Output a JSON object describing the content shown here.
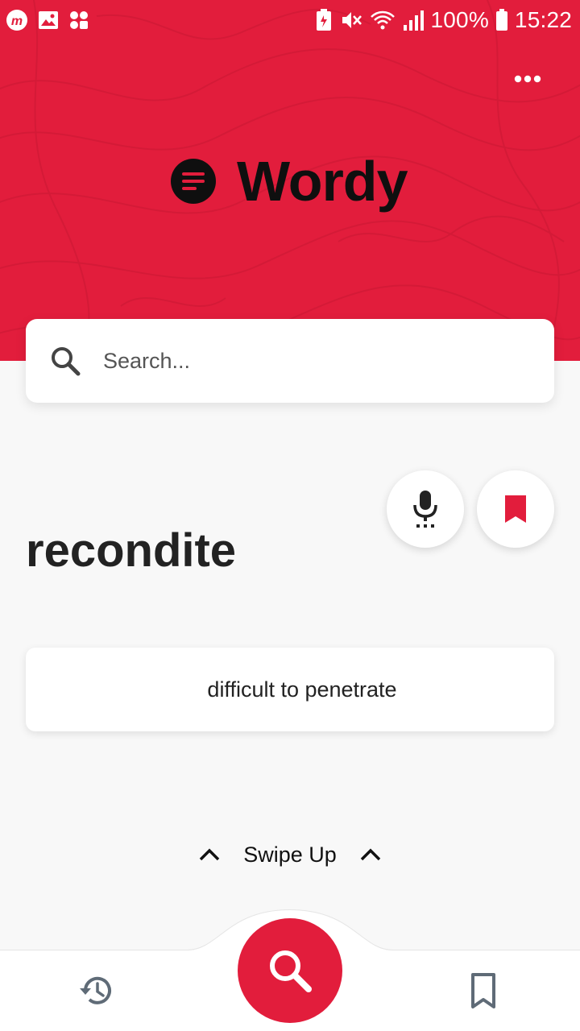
{
  "status_bar": {
    "battery_percent": "100%",
    "time": "15:22",
    "icons": [
      "app-m-icon",
      "gallery-icon",
      "apps-icon",
      "battery-saver-icon",
      "mute-icon",
      "wifi-icon",
      "signal-icon",
      "battery-icon"
    ]
  },
  "header": {
    "app_name": "Wordy",
    "more_icon": "more-horizontal-icon",
    "background_color": "#e21d3c"
  },
  "search": {
    "placeholder": "Search...",
    "value": ""
  },
  "word_view": {
    "word": "recondite",
    "definition": "difficult to penetrate",
    "pronounce_icon": "mic-icon",
    "bookmark_icon": "bookmark-icon"
  },
  "swipe_hint": {
    "label": "Swipe Up"
  },
  "bottom_nav": {
    "items": [
      "history-icon",
      "search-icon",
      "bookmark-outline-icon"
    ],
    "active": "search-icon"
  }
}
